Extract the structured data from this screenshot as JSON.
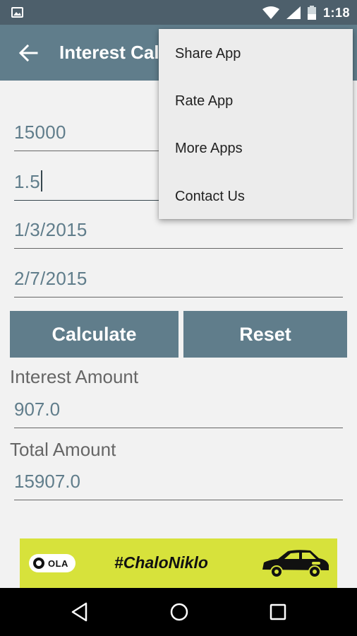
{
  "status_bar": {
    "time": "1:18"
  },
  "app_bar": {
    "title": "Interest Calculator"
  },
  "fields": {
    "principal": "15000",
    "rate": "1.5",
    "from_date": "1/3/2015",
    "to_date": "2/7/2015"
  },
  "buttons": {
    "calculate": "Calculate",
    "reset": "Reset"
  },
  "results": {
    "interest_label": "Interest Amount",
    "interest_value": "907.0",
    "total_label": "Total Amount",
    "total_value": "15907.0"
  },
  "ad": {
    "brand": "OLA",
    "tagline": "#ChaloNiklo"
  },
  "overflow_menu": {
    "items": [
      "Share App",
      "Rate App",
      "More Apps",
      "Contact Us"
    ]
  },
  "colors": {
    "primary": "#607d8b",
    "status_bar": "#4d5f6b",
    "ad_background": "#d7e23b"
  }
}
